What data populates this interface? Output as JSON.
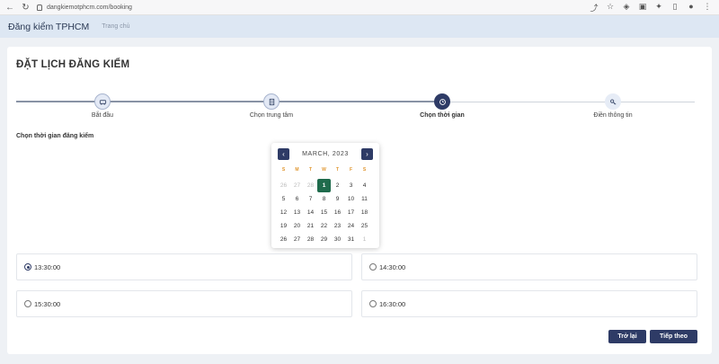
{
  "browser": {
    "url": "dangkiemotphcm.com/booking",
    "nav_icons": [
      "back-icon",
      "reload-icon",
      "info-icon"
    ],
    "action_icons": [
      "screenshot-icon",
      "star-icon",
      "shield-icon",
      "download-icon",
      "extensions-icon",
      "sidebar-icon",
      "profile-icon",
      "menu-icon"
    ]
  },
  "header": {
    "brand": "Đăng kiểm TPHCM",
    "home_link": "Trang chủ"
  },
  "page": {
    "title": "ĐẶT LỊCH ĐĂNG KIỂM"
  },
  "stepper": {
    "steps": [
      {
        "label": "Bắt đầu",
        "icon": "car-icon",
        "state": "done"
      },
      {
        "label": "Chọn trung tâm",
        "icon": "document-icon",
        "state": "done"
      },
      {
        "label": "Chọn thời gian",
        "icon": "clock-icon",
        "state": "active"
      },
      {
        "label": "Điền thông tin",
        "icon": "key-icon",
        "state": "pending"
      }
    ]
  },
  "schedule": {
    "section_label": "Chọn thời gian đăng kiểm"
  },
  "calendar": {
    "month_label": "MARCH, 2023",
    "prev_icon": "‹",
    "next_icon": "›",
    "weekdays": [
      "S",
      "M",
      "T",
      "W",
      "T",
      "F",
      "S"
    ],
    "weeks": [
      [
        "26",
        "27",
        "28",
        "1",
        "2",
        "3",
        "4"
      ],
      [
        "5",
        "6",
        "7",
        "8",
        "9",
        "10",
        "11"
      ],
      [
        "12",
        "13",
        "14",
        "15",
        "16",
        "17",
        "18"
      ],
      [
        "19",
        "20",
        "21",
        "22",
        "23",
        "24",
        "25"
      ],
      [
        "26",
        "27",
        "28",
        "29",
        "30",
        "31",
        "1"
      ]
    ],
    "selected": "1",
    "muted_cells": [
      [
        0,
        0
      ],
      [
        0,
        1
      ],
      [
        0,
        2
      ],
      [
        4,
        6
      ]
    ]
  },
  "time_slots": [
    {
      "time": "13:30:00",
      "checked": true
    },
    {
      "time": "14:30:00",
      "checked": false
    },
    {
      "time": "15:30:00",
      "checked": false
    },
    {
      "time": "16:30:00",
      "checked": false
    }
  ],
  "buttons": {
    "back": "Trở lại",
    "next": "Tiếp theo"
  },
  "colors": {
    "primary": "#2e3b66",
    "selected_day": "#1f6b4c",
    "weekday": "#e0962f",
    "header_bg": "#dde7f3"
  }
}
